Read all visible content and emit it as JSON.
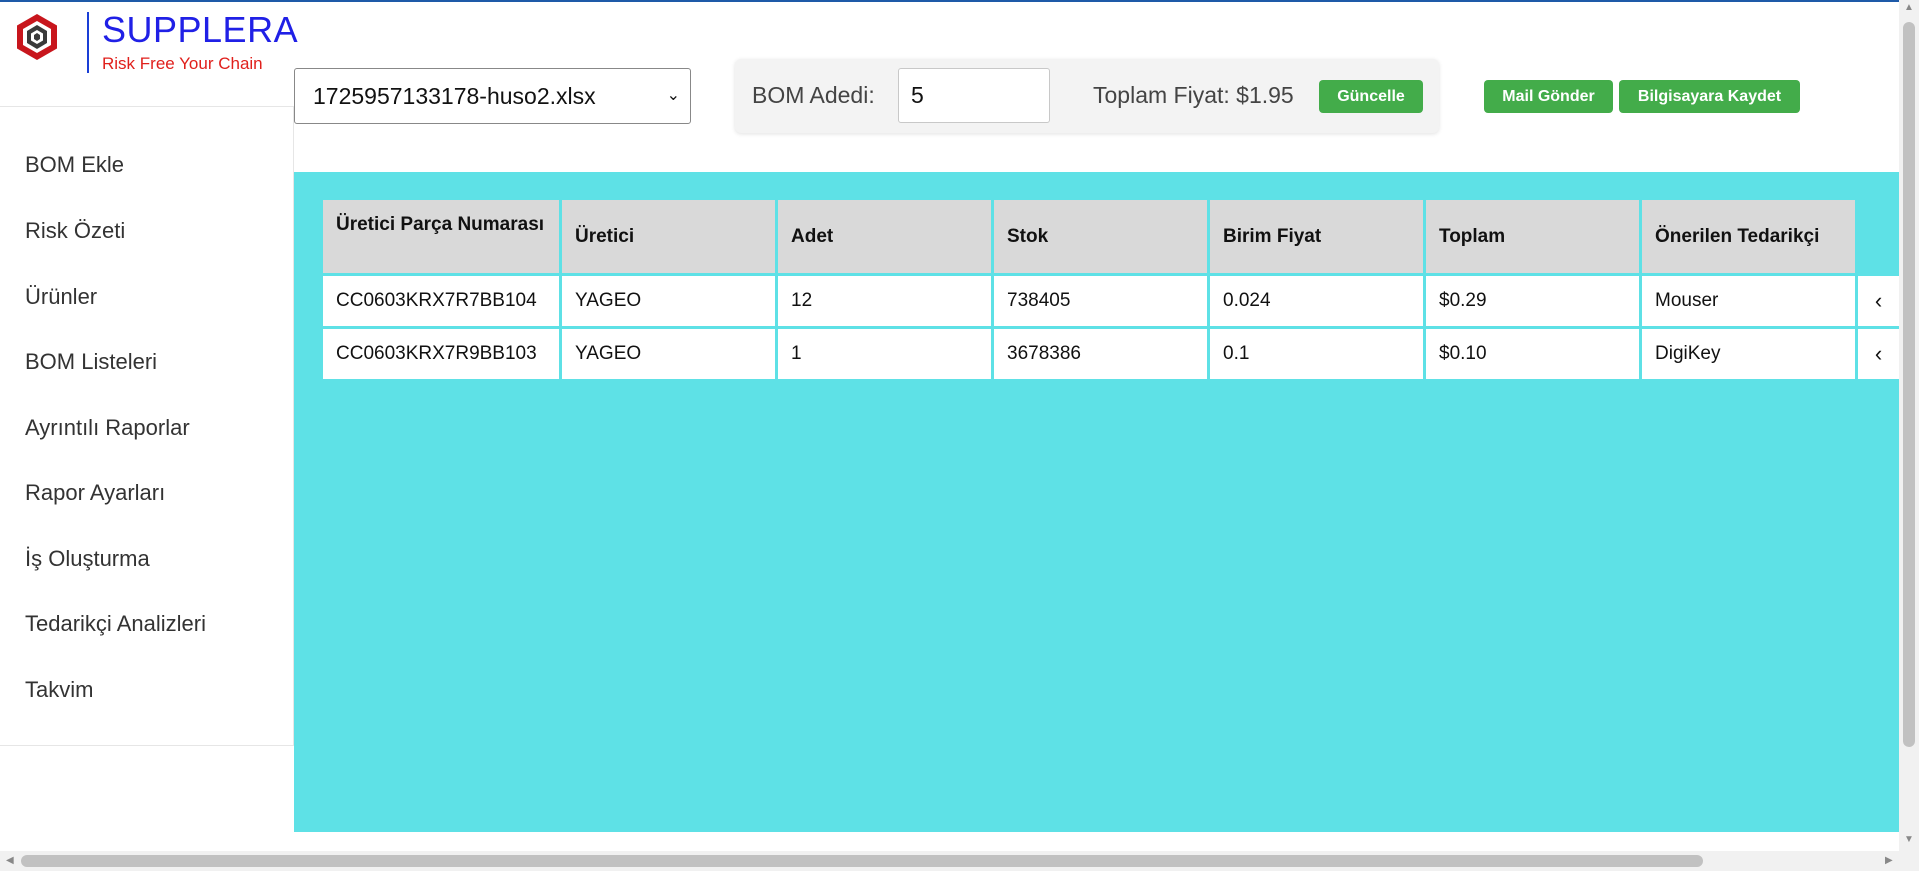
{
  "brand": {
    "name": "SUPPLERA",
    "tagline": "Risk Free Your Chain"
  },
  "sidebar": {
    "items": [
      {
        "label": "BOM Ekle"
      },
      {
        "label": "Risk Özeti"
      },
      {
        "label": "Ürünler"
      },
      {
        "label": "BOM Listeleri"
      },
      {
        "label": "Ayrıntılı Raporlar"
      },
      {
        "label": "Rapor Ayarları"
      },
      {
        "label": "İş Oluşturma"
      },
      {
        "label": "Tedarikçi Analizleri"
      },
      {
        "label": "Takvim"
      }
    ]
  },
  "toolbar": {
    "file_select_value": "1725957133178-huso2.xlsx",
    "bom_label": "BOM Adedi:",
    "bom_value": "5",
    "total_label": "Toplam Fiyat: $1.95",
    "update_button": "Güncelle",
    "mail_button": "Mail Gönder",
    "save_button": "Bilgisayara Kaydet"
  },
  "table": {
    "headers": [
      "Üretici Parça Numarası",
      "Üretici",
      "Adet",
      "Stok",
      "Birim Fiyat",
      "Toplam",
      "Önerilen Tedarikçi"
    ],
    "rows": [
      [
        "CC0603KRX7R7BB104",
        "YAGEO",
        "12",
        "738405",
        "0.024",
        "$0.29",
        "Mouser"
      ],
      [
        "CC0603KRX7R9BB103",
        "YAGEO",
        "1",
        "3678386",
        "0.1",
        "$0.10",
        "DigiKey"
      ]
    ]
  },
  "colors": {
    "accent_button": "#43ac4a",
    "main_background": "#5ee1e6",
    "brand_blue": "#2020e6",
    "brand_red": "#e0201c"
  },
  "icons": {
    "logo": "hexagon-logo-icon",
    "row_expand": "chevron-left-icon",
    "select_caret": "chevron-down-icon"
  }
}
